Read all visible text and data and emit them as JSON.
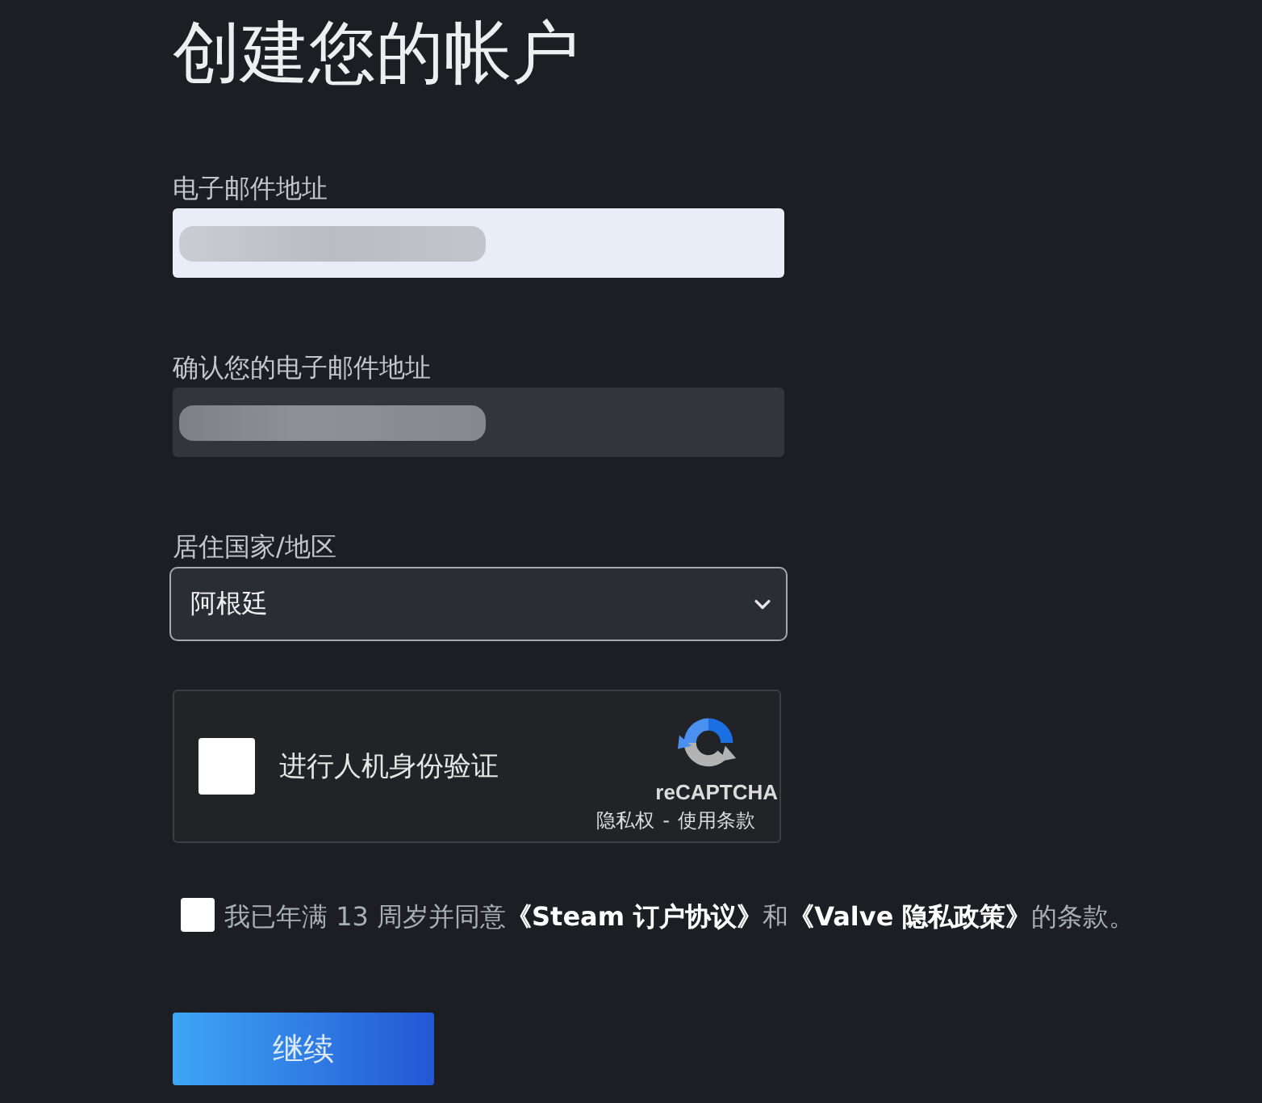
{
  "title": "创建您的帐户",
  "fields": [
    {
      "kind": "text",
      "label": "电子邮件地址",
      "focused": true,
      "blurred": true
    },
    {
      "kind": "text",
      "label": "确认您的电子邮件地址",
      "focused": false,
      "blurred": true
    },
    {
      "kind": "select",
      "label": "居住国家/地区",
      "value": "阿根廷"
    }
  ],
  "captcha": {
    "checked": false,
    "label": "进行人机身份验证",
    "brand": "reCAPTCHA",
    "links": [
      "隐私权",
      "使用条款"
    ],
    "separator": "-"
  },
  "agreement": {
    "checked": false,
    "parts": [
      {
        "kind": "text",
        "text": "我已年满 13 周岁并同意"
      },
      {
        "kind": "link",
        "text": "《Steam 订户协议》"
      },
      {
        "kind": "text",
        "text": "和"
      },
      {
        "kind": "link",
        "text": "《Valve 隐私政策》"
      },
      {
        "kind": "text",
        "text": "的条款。"
      }
    ]
  },
  "button": {
    "label": "继续"
  }
}
